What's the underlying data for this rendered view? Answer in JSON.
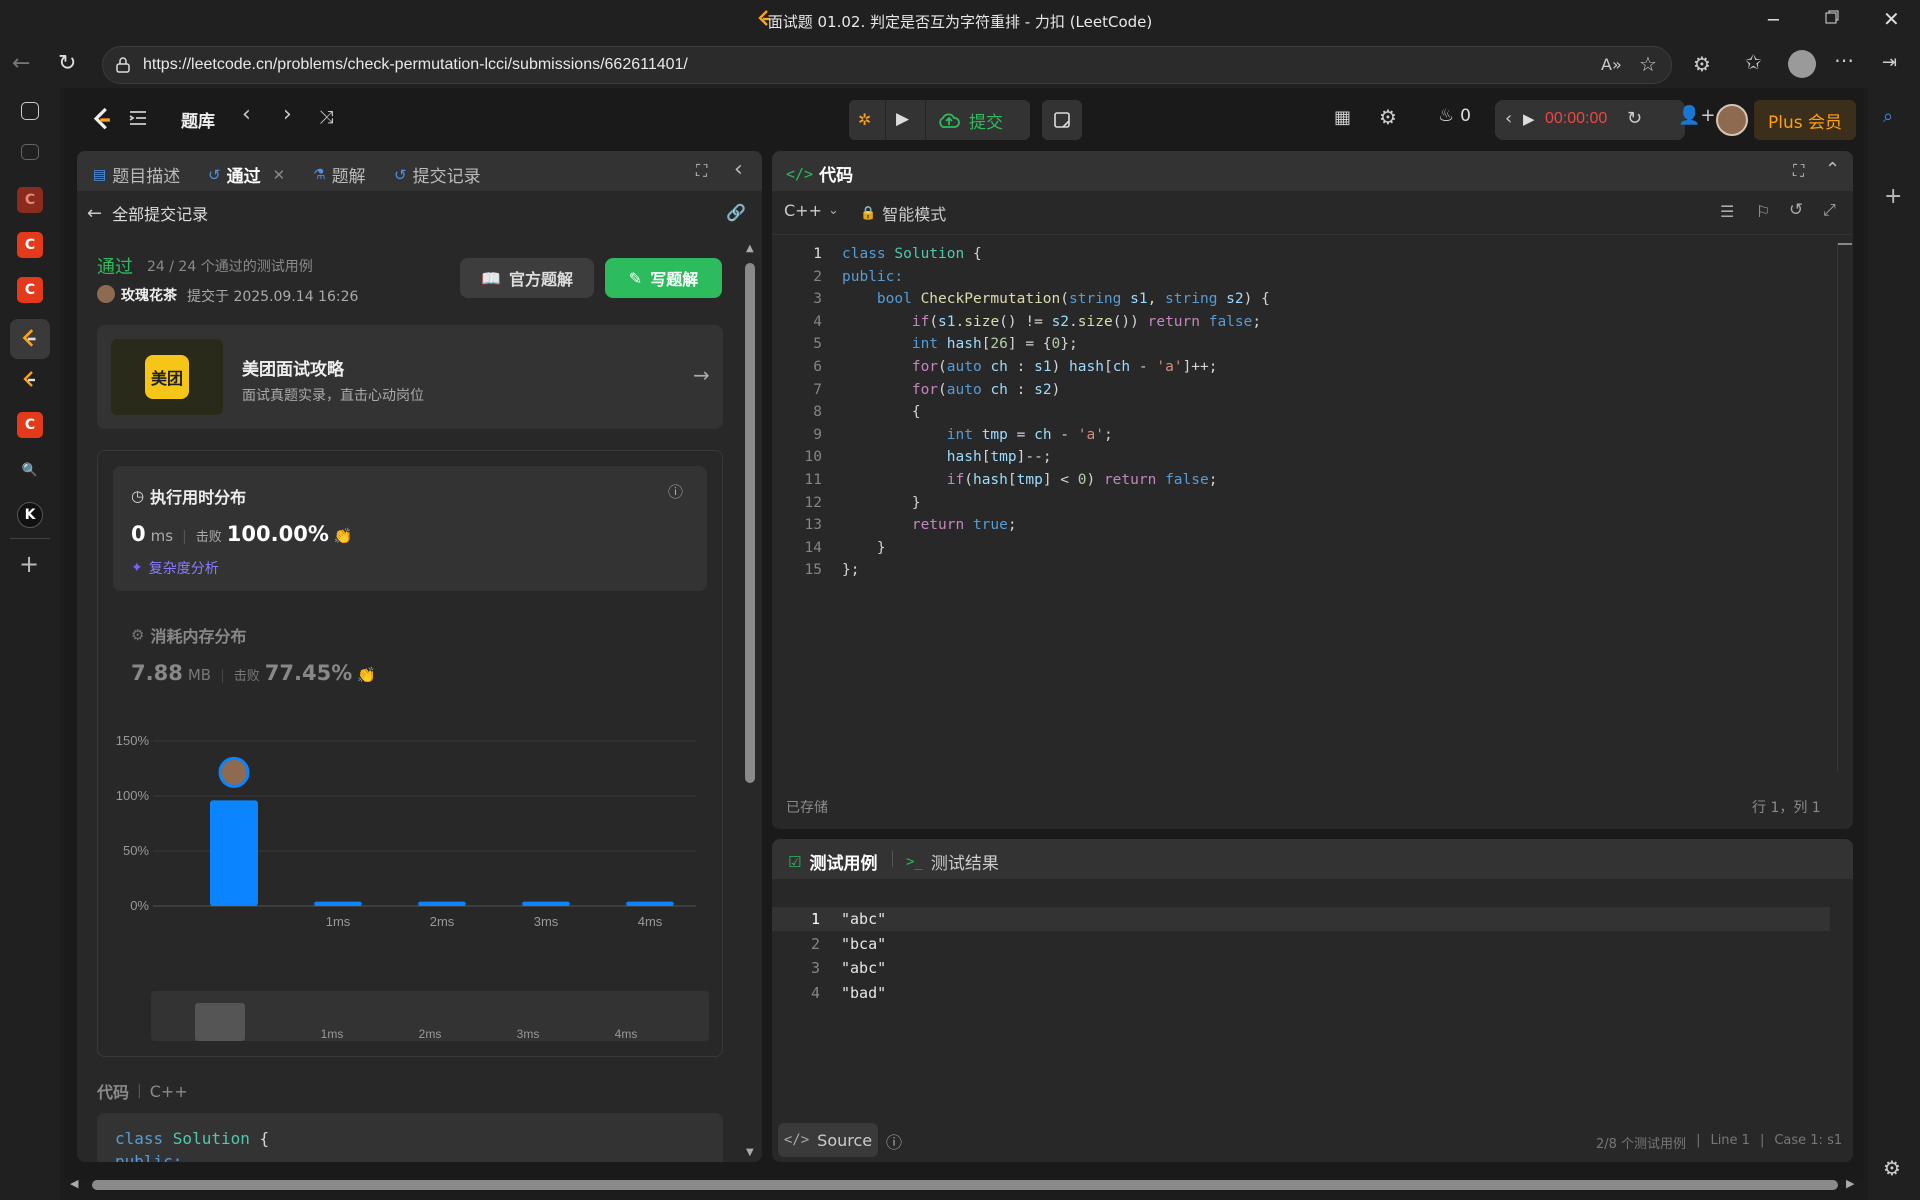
{
  "window": {
    "title": "面试题 01.02. 判定是否互为字符重排 - 力扣 (LeetCode)"
  },
  "browser": {
    "url": "https://leetcode.cn/problems/check-permutation-lcci/submissions/662611401/"
  },
  "nav": {
    "problem_bank": "题库",
    "submit": "提交",
    "streak": "0",
    "timer": "00:00:00",
    "plus": "Plus 会员"
  },
  "left_panel": {
    "tabs": [
      "题目描述",
      "通过",
      "题解",
      "提交记录"
    ],
    "back_label": "全部提交记录",
    "status": "通过",
    "cases": "24 / 24 个通过的测试用例",
    "user": "玫瑰花茶",
    "submitted_at": "提交于 2025.09.14 16:26",
    "official_solution": "官方题解",
    "write_solution": "写题解",
    "ad": {
      "logo": "美团",
      "title": "美团面试攻略",
      "subtitle": "面试真题实录，直击心动岗位"
    },
    "runtime": {
      "title": "执行用时分布",
      "value": "0",
      "unit": "ms",
      "beat_label": "击败",
      "beat": "100.00%",
      "complexity": "复杂度分析"
    },
    "memory": {
      "title": "消耗内存分布",
      "value": "7.88",
      "unit": "MB",
      "beat_label": "击败",
      "beat": "77.45%"
    },
    "code_label": "代码",
    "code_lang": "C++",
    "code_preview": [
      "class Solution {",
      "public:"
    ]
  },
  "chart_data": {
    "type": "bar",
    "categories": [
      "0ms",
      "1ms",
      "2ms",
      "3ms",
      "4ms"
    ],
    "x_tick_labels": [
      "",
      "1ms",
      "2ms",
      "3ms",
      "4ms"
    ],
    "values": [
      96,
      4,
      4,
      4,
      4
    ],
    "yticks": [
      "0%",
      "50%",
      "100%",
      "150%"
    ],
    "ylim": [
      0,
      150
    ],
    "highlight_category": "0ms",
    "bar_color": "#0a84ff",
    "grid": true
  },
  "editor": {
    "title": "代码",
    "lang": "C++",
    "mode": "智能模式",
    "saved": "已存储",
    "position": "行 1，列 1",
    "lines": [
      [
        [
          "class ",
          "ty"
        ],
        [
          "Solution",
          "cl"
        ],
        [
          " {",
          "pl"
        ]
      ],
      [
        [
          "public:",
          "ty"
        ]
      ],
      [
        [
          "    ",
          "pl"
        ],
        [
          "bool ",
          "ty"
        ],
        [
          "CheckPermutation",
          "fn"
        ],
        [
          "(",
          "pl"
        ],
        [
          "string ",
          "ty"
        ],
        [
          "s1",
          "va"
        ],
        [
          ", ",
          "pl"
        ],
        [
          "string ",
          "ty"
        ],
        [
          "s2",
          "va"
        ],
        [
          ") {",
          "pl"
        ]
      ],
      [
        [
          "        ",
          "pl"
        ],
        [
          "if",
          "kw"
        ],
        [
          "(",
          "pl"
        ],
        [
          "s1",
          "va"
        ],
        [
          ".",
          "pl"
        ],
        [
          "size",
          "fn"
        ],
        [
          "() != ",
          "pl"
        ],
        [
          "s2",
          "va"
        ],
        [
          ".",
          "pl"
        ],
        [
          "size",
          "fn"
        ],
        [
          "()) ",
          "pl"
        ],
        [
          "return ",
          "kw"
        ],
        [
          "false",
          "ty"
        ],
        [
          ";",
          "pl"
        ]
      ],
      [
        [
          "        ",
          "pl"
        ],
        [
          "int ",
          "ty"
        ],
        [
          "hash",
          "va"
        ],
        [
          "[",
          "pl"
        ],
        [
          "26",
          "nm"
        ],
        [
          "] = {",
          "pl"
        ],
        [
          "0",
          "nm"
        ],
        [
          "};",
          "pl"
        ]
      ],
      [
        [
          "        ",
          "pl"
        ],
        [
          "for",
          "kw"
        ],
        [
          "(",
          "pl"
        ],
        [
          "auto ",
          "ty"
        ],
        [
          "ch",
          "va"
        ],
        [
          " : ",
          "pl"
        ],
        [
          "s1",
          "va"
        ],
        [
          ") ",
          "pl"
        ],
        [
          "hash",
          "va"
        ],
        [
          "[",
          "pl"
        ],
        [
          "ch",
          "va"
        ],
        [
          " - ",
          "pl"
        ],
        [
          "'a'",
          "st"
        ],
        [
          "]++;",
          "pl"
        ]
      ],
      [
        [
          "        ",
          "pl"
        ],
        [
          "for",
          "kw"
        ],
        [
          "(",
          "pl"
        ],
        [
          "auto ",
          "ty"
        ],
        [
          "ch",
          "va"
        ],
        [
          " : ",
          "pl"
        ],
        [
          "s2",
          "va"
        ],
        [
          ")",
          "pl"
        ]
      ],
      [
        [
          "        {",
          "pl"
        ]
      ],
      [
        [
          "            ",
          "pl"
        ],
        [
          "int ",
          "ty"
        ],
        [
          "tmp",
          "va"
        ],
        [
          " = ",
          "pl"
        ],
        [
          "ch",
          "va"
        ],
        [
          " - ",
          "pl"
        ],
        [
          "'a'",
          "st"
        ],
        [
          ";",
          "pl"
        ]
      ],
      [
        [
          "            ",
          "pl"
        ],
        [
          "hash",
          "va"
        ],
        [
          "[",
          "pl"
        ],
        [
          "tmp",
          "va"
        ],
        [
          "]--;",
          "pl"
        ]
      ],
      [
        [
          "            ",
          "pl"
        ],
        [
          "if",
          "kw"
        ],
        [
          "(",
          "pl"
        ],
        [
          "hash",
          "va"
        ],
        [
          "[",
          "pl"
        ],
        [
          "tmp",
          "va"
        ],
        [
          "] < ",
          "pl"
        ],
        [
          "0",
          "nm"
        ],
        [
          ") ",
          "pl"
        ],
        [
          "return ",
          "kw"
        ],
        [
          "false",
          "ty"
        ],
        [
          ";",
          "pl"
        ]
      ],
      [
        [
          "        }",
          "pl"
        ]
      ],
      [
        [
          "        ",
          "pl"
        ],
        [
          "return ",
          "kw"
        ],
        [
          "true",
          "ty"
        ],
        [
          ";",
          "pl"
        ]
      ],
      [
        [
          "    }",
          "pl"
        ]
      ],
      [
        [
          "};",
          "pl"
        ]
      ]
    ]
  },
  "testcase": {
    "tab1": "测试用例",
    "tab2": "测试结果",
    "lines": [
      "\"abc\"",
      "\"bca\"",
      "\"abc\"",
      "\"bad\""
    ],
    "source": "Source",
    "status_cases": "2/8 个测试用例",
    "status_line": "Line 1",
    "status_case": "Case 1: s1"
  },
  "colors": {
    "accent_green": "#2cbb5d",
    "brand_blue": "#0a84ff",
    "plus_orange": "#ffa116",
    "timer_red": "#ef4743"
  }
}
